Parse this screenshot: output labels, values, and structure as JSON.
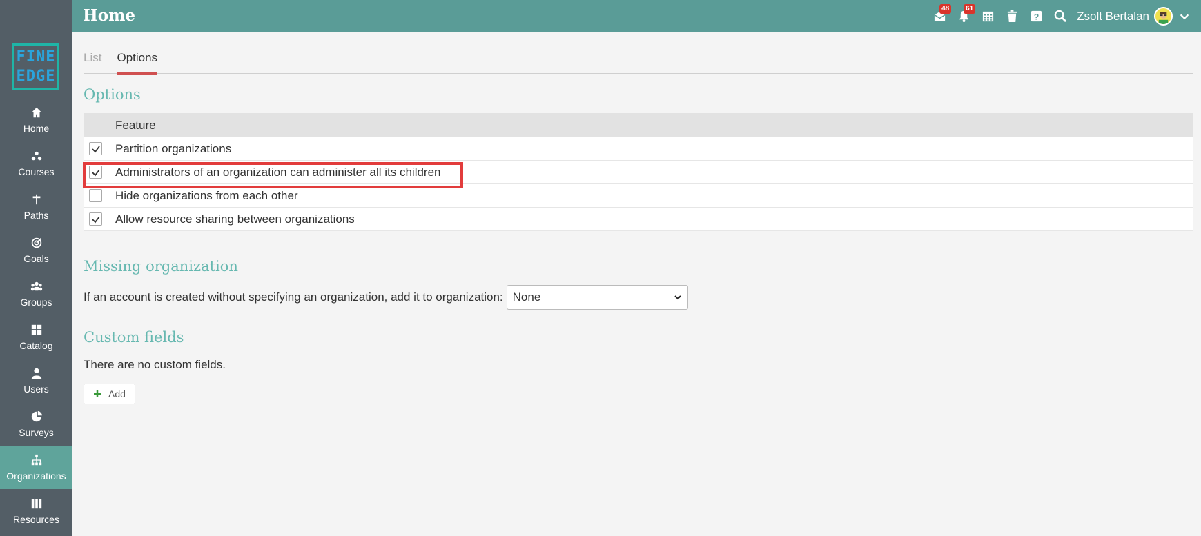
{
  "logo": {
    "line1": "FINE",
    "line2": "EDGE"
  },
  "sidebar": {
    "items": [
      {
        "label": "Home",
        "icon": "home-icon"
      },
      {
        "label": "Courses",
        "icon": "courses-icon"
      },
      {
        "label": "Paths",
        "icon": "paths-icon"
      },
      {
        "label": "Goals",
        "icon": "goals-icon"
      },
      {
        "label": "Groups",
        "icon": "groups-icon"
      },
      {
        "label": "Catalog",
        "icon": "catalog-icon"
      },
      {
        "label": "Users",
        "icon": "users-icon"
      },
      {
        "label": "Surveys",
        "icon": "surveys-icon"
      },
      {
        "label": "Organizations",
        "icon": "organizations-icon",
        "active": true
      },
      {
        "label": "Resources",
        "icon": "resources-icon"
      }
    ]
  },
  "header": {
    "title": "Home",
    "messages_badge": "48",
    "notifications_badge": "61",
    "user_name": "Zsolt Bertalan"
  },
  "tabs": [
    {
      "label": "List"
    },
    {
      "label": "Options",
      "active": true
    }
  ],
  "options": {
    "title": "Options",
    "column_header": "Feature",
    "rows": [
      {
        "label": "Partition organizations",
        "checked": true
      },
      {
        "label": "Administrators of an organization can administer all its children",
        "checked": true
      },
      {
        "label": "Hide organizations from each other",
        "checked": false
      },
      {
        "label": "Allow resource sharing between organizations",
        "checked": true
      }
    ]
  },
  "missing": {
    "title": "Missing organization",
    "description": "If an account is created without specifying an organization, add it to organization:",
    "selected": "None"
  },
  "custom": {
    "title": "Custom fields",
    "empty_text": "There are no custom fields.",
    "add_label": "Add"
  },
  "colors": {
    "header_bg": "#5a9c97",
    "sidebar_bg": "#535e66",
    "active_nav": "#5fa49b",
    "section_title": "#66b8b0",
    "highlight": "#e23c3c",
    "badge": "#d9342b"
  }
}
